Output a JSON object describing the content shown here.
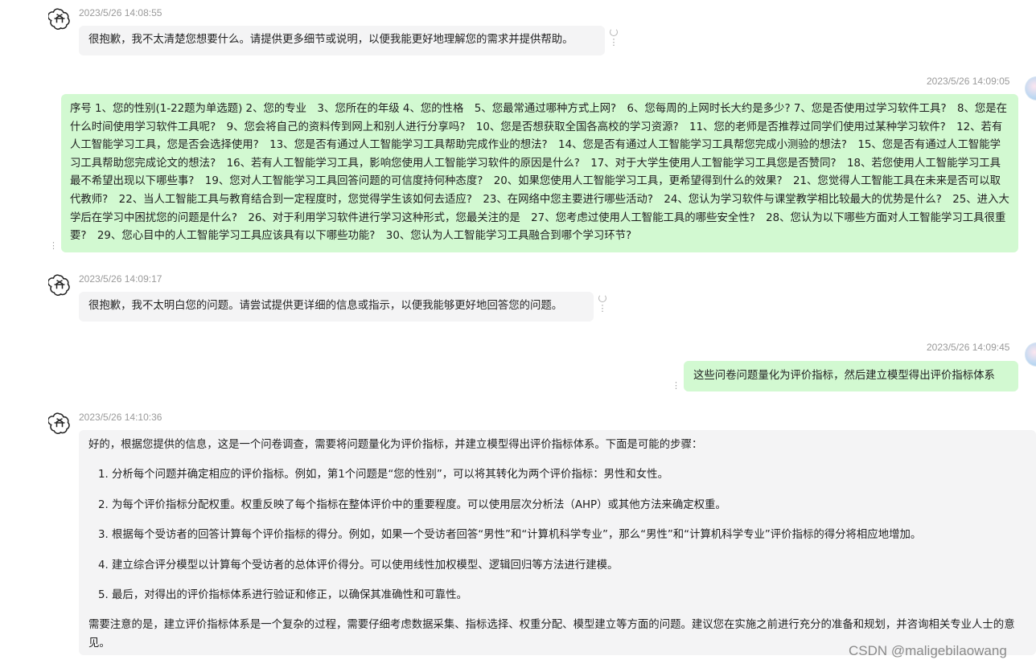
{
  "colors": {
    "bot_bubble": "#f4f4f5",
    "user_bubble": "#d2f9d1",
    "timestamp": "#9a9a9a"
  },
  "messages": [
    {
      "role": "assistant",
      "timestamp": "2023/5/26 14:08:55",
      "text": "很抱歉，我不太清楚您想要什么。请提供更多细节或说明，以便我能更好地理解您的需求并提供帮助。"
    },
    {
      "role": "user",
      "timestamp": "2023/5/26 14:09:05",
      "text": "序号 1、您的性别(1-22题为单选题) 2、您的专业　3、您所在的年级 4、您的性格　5、您最常通过哪种方式上网?　6、您每周的上网时长大约是多少? 7、您是否使用过学习软件工具?　8、您是在什么时间使用学习软件工具呢?　9、您会将自己的资料传到网上和别人进行分享吗?　10、您是否想获取全国各高校的学习资源?　11、您的老师是否推荐过同学们使用过某种学习软件?　12、若有人工智能学习工具，您是否会选择使用?　13、您是否有通过人工智能学习工具帮助完成作业的想法?　14、您是否有通过人工智能学习工具帮您完成小测验的想法?　15、您是否有通过人工智能学习工具帮助您完成论文的想法?　16、若有人工智能学习工具，影响您使用人工智能学习软件的原因是什么?　17、对于大学生使用人工智能学习工具您是否赞同?　18、若您使用人工智能学习工具最不希望出现以下哪些事?　19、您对人工智能学习工具回答问题的可信度持何种态度?　20、如果您使用人工智能学习工具，更希望得到什么的效果?　21、您觉得人工智能工具在未来是否可以取代教师?　22、当人工智能工具与教育结合到一定程度时，您觉得学生该如何去适应?　23、在网络中您主要进行哪些活动?　24、您认为学习软件与课堂教学相比较最大的优势是什么?　25、进入大学后在学习中困扰您的问题是什么?　26、对于利用学习软件进行学习这种形式，您最关注的是　27、您考虑过使用人工智能工具的哪些安全性?　28、您认为以下哪些方面对人工智能学习工具很重要?　29、您心目中的人工智能学习工具应该具有以下哪些功能?　30、您认为人工智能学习工具融合到哪个学习环节?"
    },
    {
      "role": "assistant",
      "timestamp": "2023/5/26 14:09:17",
      "text": "很抱歉，我不太明白您的问题。请尝试提供更详细的信息或指示，以便我能够更好地回答您的问题。"
    },
    {
      "role": "user",
      "timestamp": "2023/5/26 14:09:45",
      "text": "这些问卷问题量化为评价指标，然后建立模型得出评价指标体系"
    },
    {
      "role": "assistant",
      "timestamp": "2023/5/26 14:10:36",
      "intro": "好的，根据您提供的信息，这是一个问卷调查，需要将问题量化为评价指标，并建立模型得出评价指标体系。下面是可能的步骤：",
      "steps": [
        "1. 分析每个问题并确定相应的评价指标。例如，第1个问题是“您的性别”，可以将其转化为两个评价指标：男性和女性。",
        "2. 为每个评价指标分配权重。权重反映了每个指标在整体评价中的重要程度。可以使用层次分析法（AHP）或其他方法来确定权重。",
        "3. 根据每个受访者的回答计算每个评价指标的得分。例如，如果一个受访者回答“男性”和“计算机科学专业”，那么“男性”和“计算机科学专业”评价指标的得分将相应地增加。",
        "4. 建立综合评分模型以计算每个受访者的总体评价得分。可以使用线性加权模型、逻辑回归等方法进行建模。",
        "5. 最后，对得出的评价指标体系进行验证和修正，以确保其准确性和可靠性。"
      ],
      "outro": "需要注意的是，建立评价指标体系是一个复杂的过程，需要仔细考虑数据采集、指标选择、权重分配、模型建立等方面的问题。建议您在实施之前进行充分的准备和规划，并咨询相关专业人士的意见。"
    }
  ],
  "watermark": "CSDN @maligebilaowang",
  "icons": {
    "assistant_avatar": "openai-logo-icon",
    "user_avatar": "user-avatar-icon",
    "regenerate": "refresh-icon",
    "more": "more-vertical-icon"
  }
}
